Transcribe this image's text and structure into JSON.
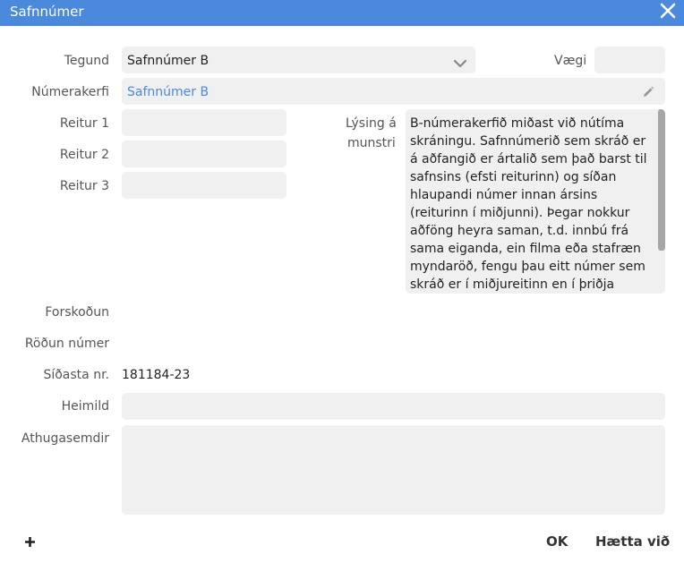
{
  "dialog": {
    "title": "Safnnúmer",
    "close_icon": "close-icon"
  },
  "form": {
    "tegund": {
      "label": "Tegund",
      "value": "Safnnúmer B",
      "icon": "chevron-down-icon"
    },
    "vaegi": {
      "label": "Vægi",
      "value": ""
    },
    "numerakerfi": {
      "label": "Númerakerfi",
      "value": "Safnnúmer B",
      "icon": "pencil-icon",
      "link_color": "#4a89dc"
    },
    "reitur1": {
      "label": "Reitur 1",
      "value": ""
    },
    "reitur2": {
      "label": "Reitur 2",
      "value": ""
    },
    "reitur3": {
      "label": "Reitur 3",
      "value": ""
    },
    "lysing": {
      "label_line1": "Lýsing á",
      "label_line2": "munstri",
      "lines": [
        "B-númerakerfið miðast við nútíma",
        "skráningu. Safnnúmerið sem skráð er",
        "á aðfangið er ártalið sem það barst til",
        "safnsins (efsti reiturinn) og síðan",
        "hlaupandi númer innan ársins",
        "(reiturinn í miðjunni). Þegar nokkur",
        "aðföng heyra saman, t.d. innbú frá",
        "sama eiganda, ein filma eða stafræn",
        "myndaröð, fengu þau eitt númer sem",
        "skráð er í miðjureitinn en í þriðja"
      ]
    },
    "forskodun": {
      "label": "Forskoðun",
      "value": ""
    },
    "rodun": {
      "label": "Röðun númer",
      "value": ""
    },
    "sidasta": {
      "label": "Síðasta nr.",
      "value": "181184-23"
    },
    "heimild": {
      "label": "Heimild",
      "value": ""
    },
    "athugasemdir": {
      "label": "Athugasemdir",
      "value": ""
    }
  },
  "footer": {
    "add_icon": "plus-icon",
    "ok_label": "OK",
    "cancel_label": "Hætta við"
  }
}
